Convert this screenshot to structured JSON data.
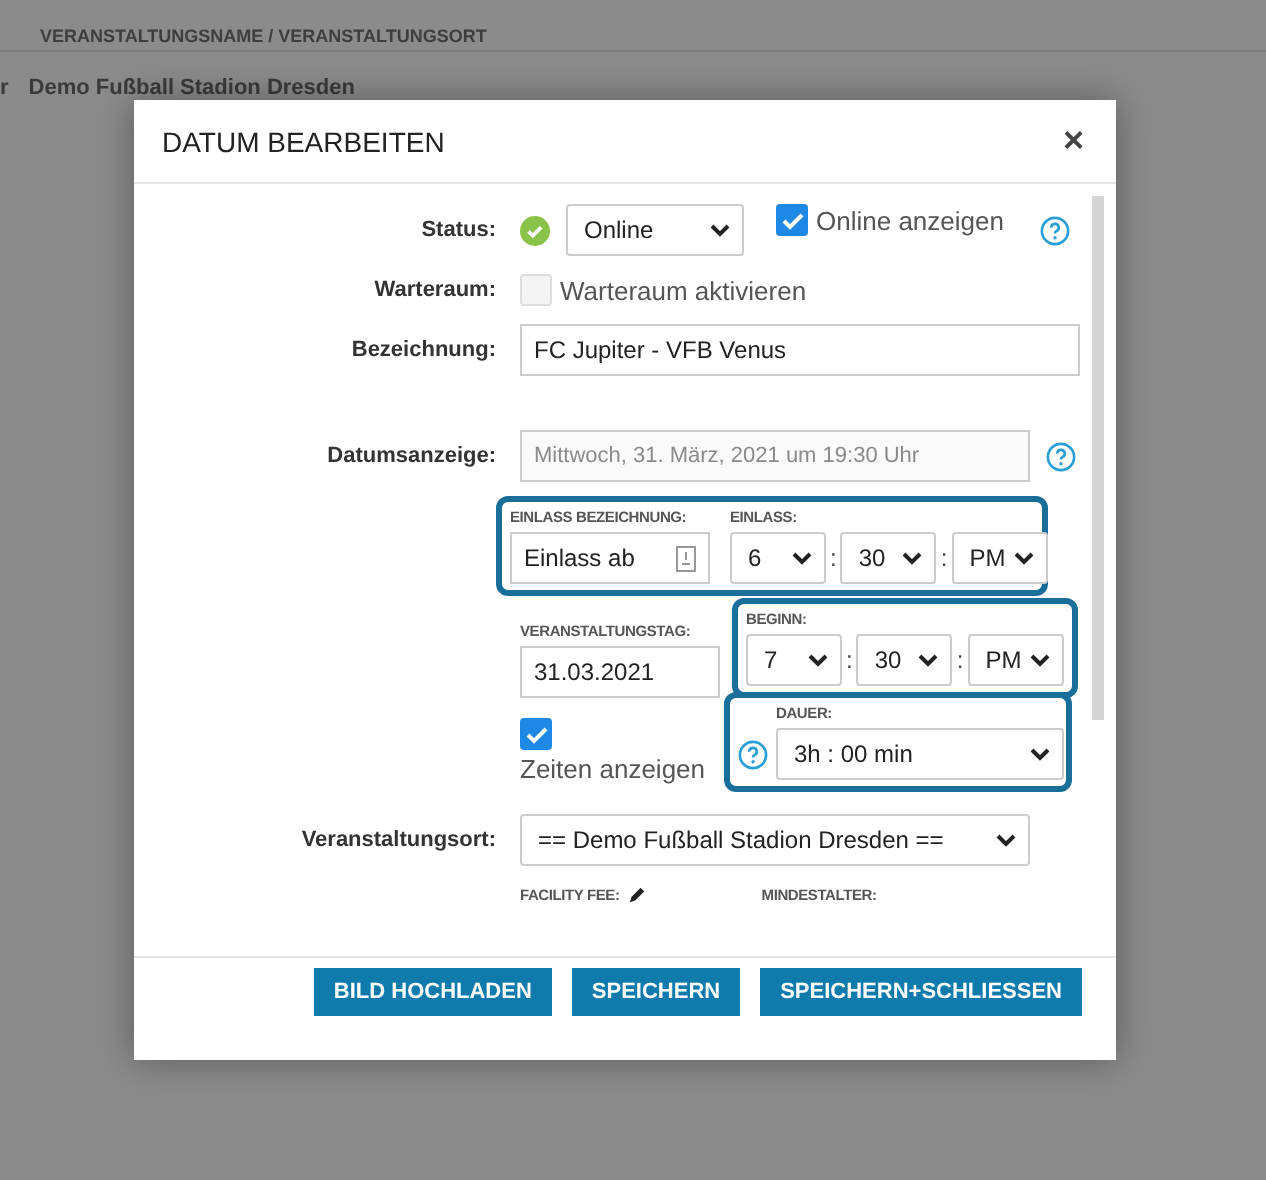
{
  "background": {
    "breadcrumb": "VERANSTALTUNGSNAME / VERANSTALTUNGSORT",
    "edge_text": "r",
    "venue_text": "Demo Fußball Stadion Dresden"
  },
  "dialog": {
    "title": "DATUM BEARBEITEN",
    "close": "×"
  },
  "status": {
    "label": "Status:",
    "ok": true,
    "value": "Online",
    "online_checkbox": {
      "label": "Online anzeigen",
      "checked": true
    }
  },
  "waiting_room": {
    "label": "Warteraum:",
    "checkbox": {
      "label": "Warteraum aktivieren",
      "checked": false
    }
  },
  "name": {
    "label": "Bezeichnung:",
    "value": "FC Jupiter - VFB Venus"
  },
  "date_display": {
    "label": "Datumsanzeige:",
    "value": "Mittwoch, 31. März, 2021 um 19:30 Uhr",
    "disabled": true
  },
  "entry_label": {
    "label": "EINLASS BEZEICHNUNG:",
    "value": "Einlass ab",
    "highlighted": true
  },
  "entry_time": {
    "label": "EINLASS:",
    "hour": "6",
    "separator_1": ":",
    "minute": "30",
    "separator_2": ":",
    "ampm": "PM"
  },
  "event_day": {
    "label": "VERANSTALTUNGSTAG:",
    "value": "31.03.2021"
  },
  "start_time": {
    "label": "BEGINN:",
    "hour": "7",
    "separator_1": ":",
    "minute": "30",
    "separator_2": ":",
    "ampm": "PM",
    "highlighted": true
  },
  "show_times": {
    "label": "Zeiten anzeigen",
    "checked": true
  },
  "duration": {
    "label": "DAUER:",
    "value": "3h : 00 min",
    "highlighted": true
  },
  "venue": {
    "label": "Veranstaltungsort:",
    "value": "== Demo Fußball Stadion Dresden =="
  },
  "facility_fee": {
    "label": "FACILITY FEE:"
  },
  "min_age": {
    "label": "MINDESTALTER:"
  },
  "buttons": [
    "BILD HOCHLADEN",
    "SPEICHERN",
    "SPEICHERN+SCHLIESSEN"
  ]
}
